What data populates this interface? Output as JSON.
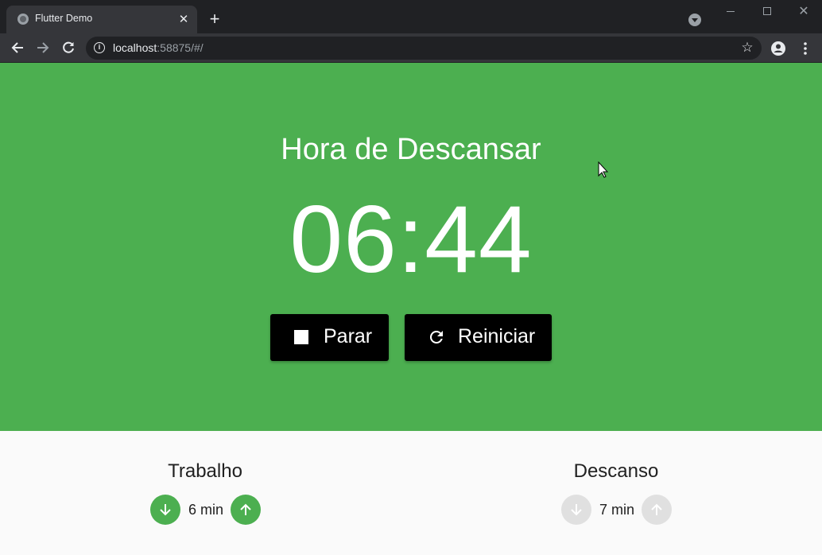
{
  "browser": {
    "tab_title": "Flutter Demo",
    "tab_close": "✕",
    "new_tab": "+",
    "url_host": "localhost",
    "url_rest": ":58875/#/",
    "info_glyph": "i",
    "star_glyph": "☆",
    "window_controls": {
      "close": "✕"
    }
  },
  "app": {
    "status_title": "Hora de Descansar",
    "timer": "06:44",
    "buttons": {
      "stop": {
        "label": "Parar",
        "icon": "stop-icon"
      },
      "reset": {
        "label": "Reiniciar",
        "icon": "refresh-icon"
      }
    },
    "settings": {
      "work": {
        "title": "Trabalho",
        "value": "6 min",
        "enabled": true
      },
      "rest": {
        "title": "Descanso",
        "value": "7 min",
        "enabled": false
      }
    }
  },
  "colors": {
    "accent": "#4caf50",
    "disabled": "#e0e0e0",
    "button": "#000000"
  }
}
